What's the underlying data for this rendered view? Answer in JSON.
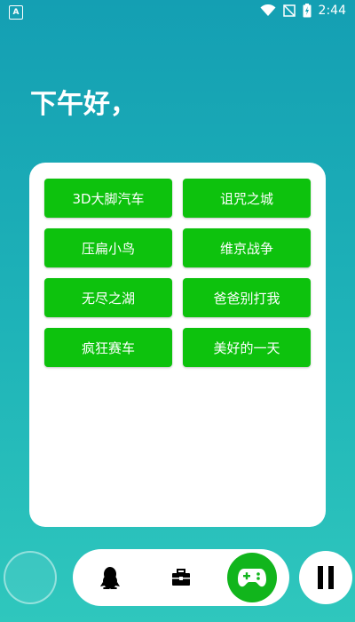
{
  "status_bar": {
    "time": "2:44",
    "app_icon": "a-app-icon",
    "wifi_icon": "wifi-icon",
    "signal_icon": "no-signal-icon",
    "battery_icon": "battery-charging-icon"
  },
  "greeting": "下午好，",
  "games": [
    {
      "label": "3D大脚汽车"
    },
    {
      "label": "诅咒之城"
    },
    {
      "label": "压扁小鸟"
    },
    {
      "label": "维京战争"
    },
    {
      "label": "无尽之湖"
    },
    {
      "label": "爸爸别打我"
    },
    {
      "label": "疯狂赛车"
    },
    {
      "label": "美好的一天"
    }
  ],
  "bottom_nav": {
    "items": [
      "qq-penguin-icon",
      "briefcase-icon",
      "gamepad-icon"
    ],
    "active": "gamepad-icon"
  },
  "colors": {
    "background_top": "#149fb3",
    "background_bottom": "#2fc7bd",
    "button_green": "#0dc20d",
    "active_nav_green": "#11b51c"
  }
}
